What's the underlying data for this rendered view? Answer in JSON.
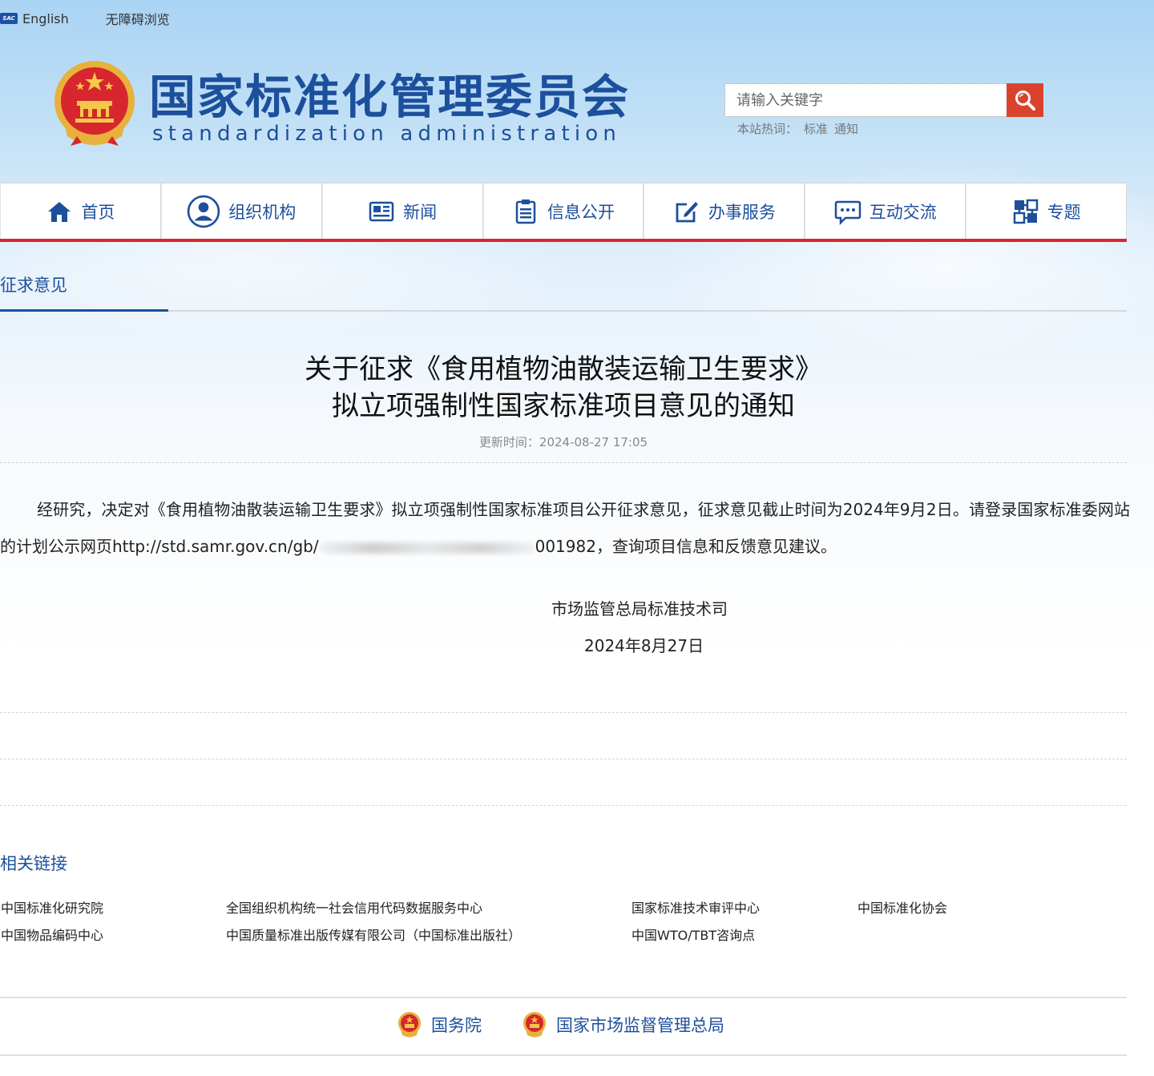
{
  "topbar": {
    "logo_text": "SAC",
    "english_label": "English",
    "accessibility_label": "无障碍浏览"
  },
  "header": {
    "title_cn": "国家标准化管理委员会",
    "title_en": "standardization administration",
    "search": {
      "placeholder": "请输入关键字"
    },
    "hot_label": "本站热词：",
    "hot_words": [
      "标准",
      "通知"
    ]
  },
  "nav": {
    "items": [
      {
        "label": "首页",
        "icon": "home-icon"
      },
      {
        "label": "组织机构",
        "icon": "person-icon"
      },
      {
        "label": "新闻",
        "icon": "newspaper-icon"
      },
      {
        "label": "信息公开",
        "icon": "clipboard-icon"
      },
      {
        "label": "办事服务",
        "icon": "edit-icon"
      },
      {
        "label": "互动交流",
        "icon": "chat-icon"
      },
      {
        "label": "专题",
        "icon": "topics-icon"
      }
    ]
  },
  "section": {
    "tab_label": "征求意见"
  },
  "article": {
    "title_line1": "关于征求《食用植物油散装运输卫生要求》",
    "title_line2": "拟立项强制性国家标准项目意见的通知",
    "update_time": "更新时间：2024-08-27 17:05",
    "body_part1": "经研究，决定对《食用植物油散装运输卫生要求》拟立项强制性国家标准项目公开征求意见，征求意见截止时间为2024年9月2日。请登录国家标准委网站的计划公示网页http://std.samr.gov.cn/gb/",
    "body_part2": "001982，查询项目信息和反馈意见建议。",
    "signature_dept": "市场监管总局标准技术司",
    "signature_date": "2024年8月27日"
  },
  "related_links": {
    "title": "相关链接",
    "items": [
      "中国标准化研究院",
      "全国组织机构统一社会信用代码数据服务中心",
      "国家标准技术审评中心",
      "中国标准化协会",
      "中国物品编码中心",
      "中国质量标准出版传媒有限公司（中国标准出版社）",
      "中国WTO/TBT咨询点"
    ]
  },
  "footer": {
    "links": [
      "国务院",
      "国家市场监督管理总局"
    ]
  },
  "colors": {
    "brand_blue": "#1c4f9c",
    "accent_red": "#d7262e",
    "search_button": "#d9432d"
  }
}
